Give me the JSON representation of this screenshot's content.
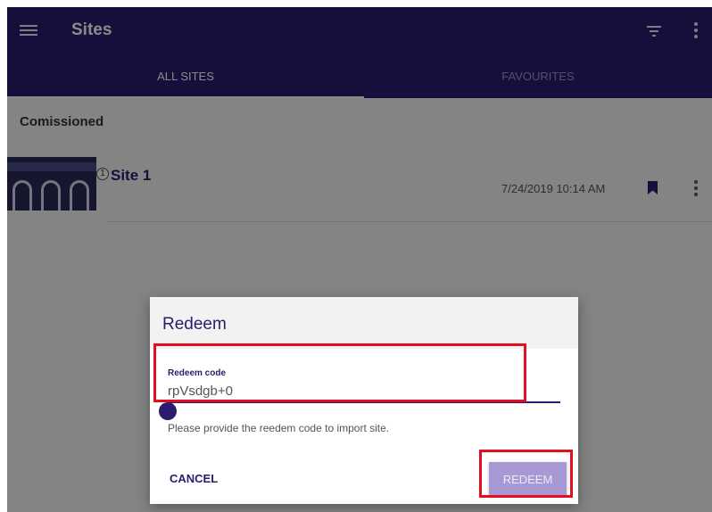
{
  "header": {
    "title": "Sites",
    "menu_icon": "hamburger-menu-icon",
    "filter_icon": "filter-icon",
    "overflow_icon": "more-vert-icon",
    "color": "#2d1b6e"
  },
  "tabs": [
    {
      "label": "ALL SITES",
      "active": true
    },
    {
      "label": "FAVOURITES",
      "active": false
    }
  ],
  "section": {
    "title": "Comissioned"
  },
  "sites": [
    {
      "name": "Site 1",
      "badge": "1",
      "date": "7/24/2019 10:14 AM",
      "bookmark_icon": "bookmark-icon",
      "overflow_icon": "more-vert-icon"
    }
  ],
  "dialog": {
    "title": "Redeem",
    "field_label": "Redeem code",
    "field_value": "rpVsdgb+0",
    "helper_text": "Please provide the reedem code to import site.",
    "cancel_label": "CANCEL",
    "redeem_label": "REDEEM",
    "redeem_color": "#a898d4"
  },
  "highlight_color": "#e0101e"
}
